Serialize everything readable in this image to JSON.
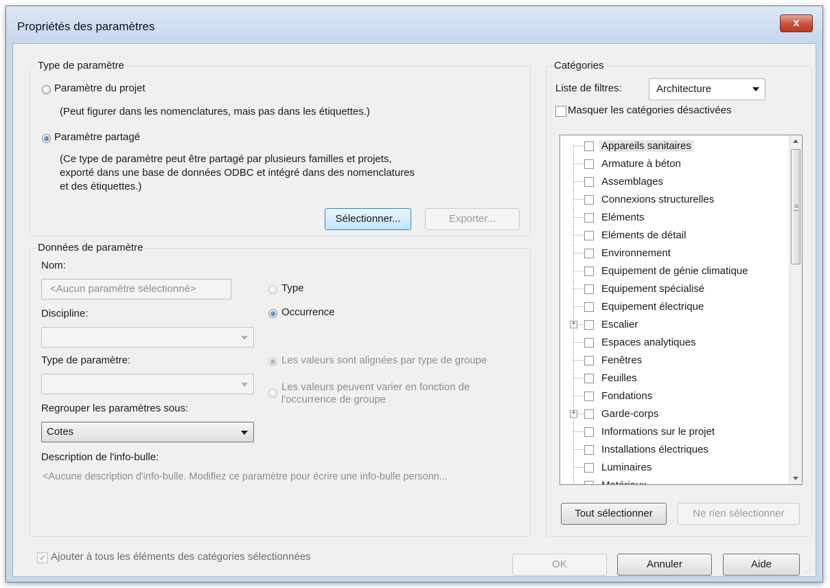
{
  "window": {
    "title": "Propriétés des paramètres",
    "close_glyph": "x"
  },
  "param_type": {
    "group_title": "Type de paramètre",
    "project_label": "Paramètre du projet",
    "project_desc": "(Peut figurer dans les nomenclatures, mais pas dans les étiquettes.)",
    "shared_label": "Paramètre partagé",
    "shared_desc": [
      "(Ce type de paramètre peut être partagé par plusieurs familles et projets,",
      "exporté dans une base de données ODBC et intégré dans des nomenclatures",
      "et des étiquettes.)"
    ],
    "select_button": "Sélectionner...",
    "export_button": "Exporter...",
    "selected": "shared"
  },
  "param_data": {
    "group_title": "Données de paramètre",
    "name_label": "Nom:",
    "name_placeholder": "<Aucun paramètre sélectionné>",
    "type_radio": "Type",
    "occurrence_radio": "Occurrence",
    "discipline_label": "Discipline:",
    "param_type_label": "Type de paramètre:",
    "aligned_radio": "Les valeurs sont alignées par type de groupe",
    "vary_radio": [
      "Les valeurs peuvent varier en fonction de",
      "l'occurrence de groupe"
    ],
    "group_under_label": "Regrouper les paramètres sous:",
    "group_under_value": "Cotes",
    "tooltip_label": "Description de l'info-bulle:",
    "tooltip_placeholder": "<Aucune description d'info-bulle. Modifiez ce paramètre pour écrire une info-bulle personn..."
  },
  "categories": {
    "group_title": "Catégories",
    "filter_label": "Liste de filtres:",
    "filter_value": "Architecture",
    "hide_label": "Masquer les catégories désactivées",
    "items": [
      "Appareils sanitaires",
      "Armature à béton",
      "Assemblages",
      "Connexions structurelles",
      "Eléments",
      "Eléments de détail",
      "Environnement",
      "Equipement de génie climatique",
      "Equipement spécialisé",
      "Equipement électrique",
      "Escalier",
      "Espaces analytiques",
      "Fenêtres",
      "Feuilles",
      "Fondations",
      "Garde-corps",
      "Informations sur le projet",
      "Installations électriques",
      "Luminaires",
      "Matériaux"
    ],
    "expandable": [
      "Escalier",
      "Garde-corps"
    ],
    "select_all_button": "Tout sélectionner",
    "select_none_button": "Ne rien sélectionner"
  },
  "footer": {
    "add_all_label": "Ajouter à tous les éléments des catégories sélectionnées",
    "ok_button": "OK",
    "cancel_button": "Annuler",
    "help_button": "Aide"
  }
}
